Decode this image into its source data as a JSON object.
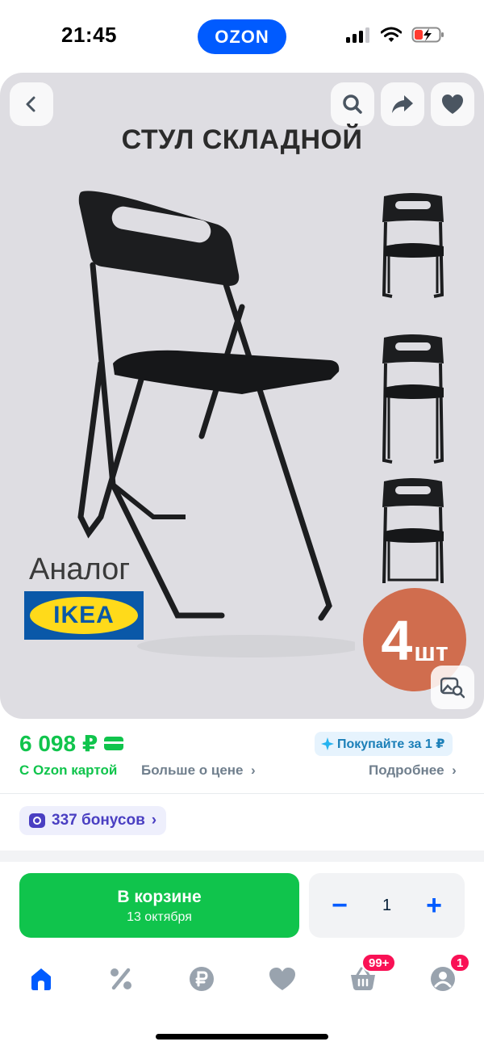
{
  "status_bar": {
    "time": "21:45",
    "brand": "OZON"
  },
  "product": {
    "banner_title": "СТУЛ СКЛАДНОЙ",
    "analog_text": "Аналог",
    "brand_logo_text": "IKEA",
    "quantity_badge": {
      "number": "4",
      "unit": "шт"
    }
  },
  "price": {
    "amount": "6 098 ₽",
    "card_note": "С Ozon картой",
    "more_link": "Больше о цене",
    "promo_text": "Покупайте за 1 ₽",
    "details_link": "Подробнее",
    "bonus_text": "337 бонусов"
  },
  "cart": {
    "button_label": "В корзине",
    "delivery_date": "13 октября",
    "quantity": "1",
    "minus": "−",
    "plus": "+"
  },
  "tabbar": {
    "cart_badge": "99+",
    "profile_badge": "1"
  },
  "colors": {
    "brand_blue": "#005bff",
    "green": "#10c44c",
    "badge_pink": "#f91155",
    "hero_bg": "#dedde2"
  },
  "icons": [
    "back-icon",
    "search-icon",
    "share-icon",
    "heart-icon",
    "visual-search-icon",
    "home-icon",
    "discount-icon",
    "ruble-icon",
    "favorites-icon",
    "cart-icon",
    "profile-icon"
  ]
}
